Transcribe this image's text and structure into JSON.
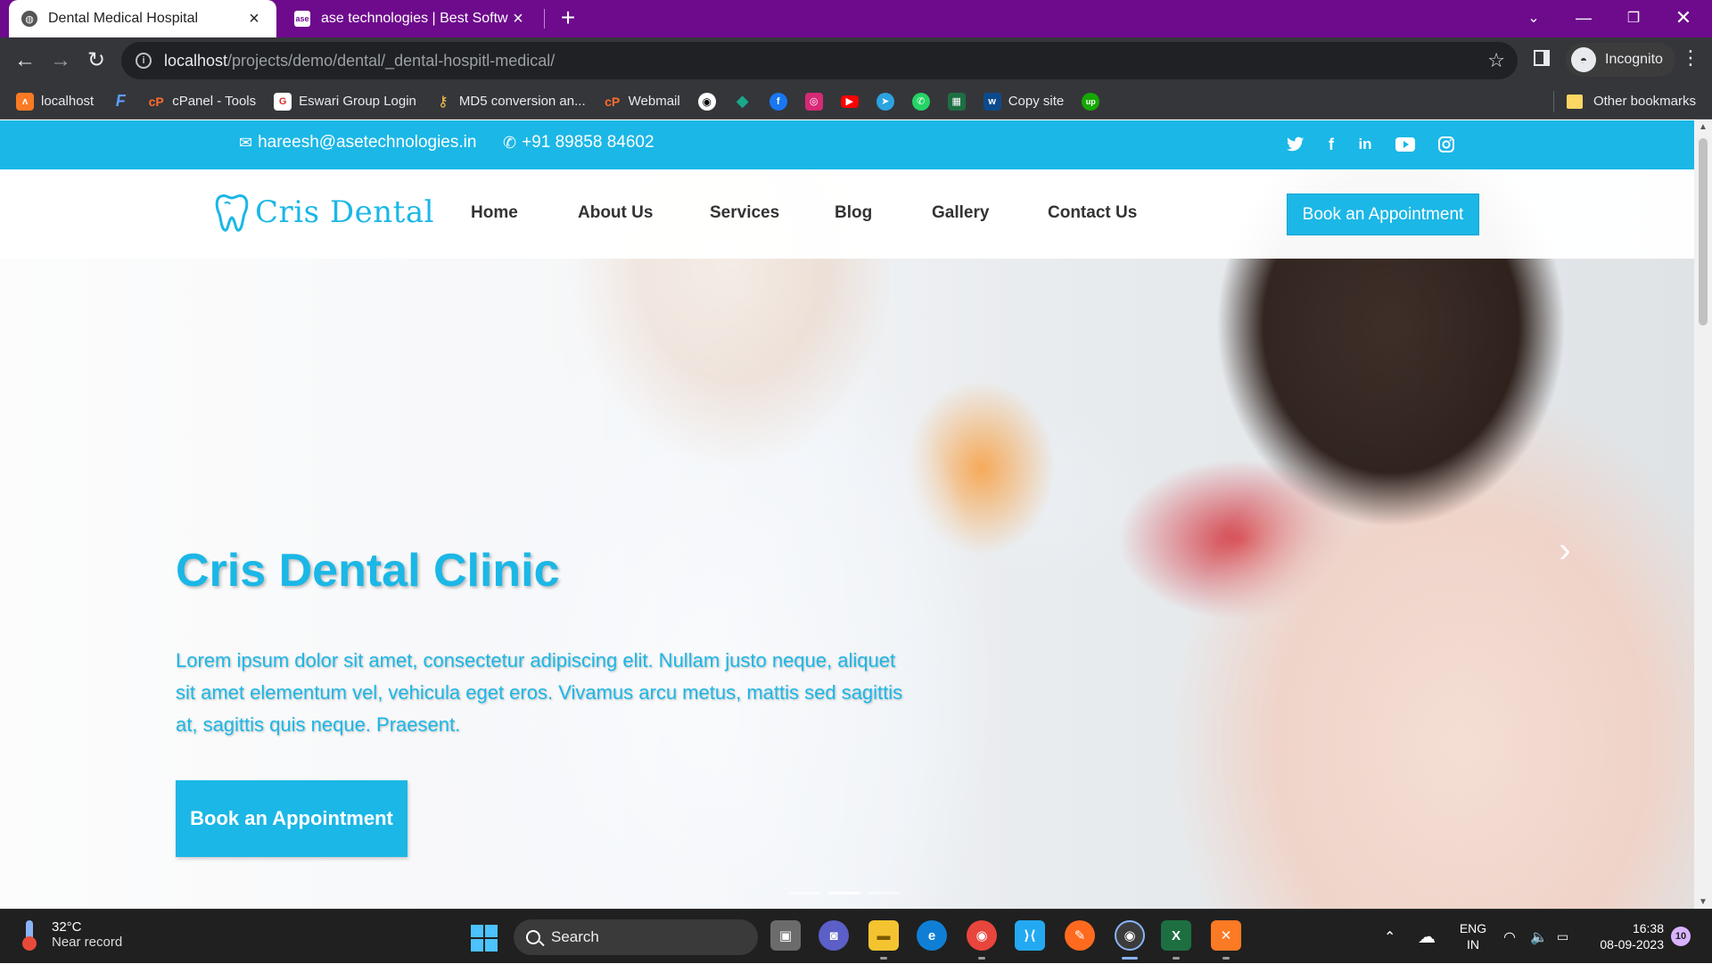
{
  "browser": {
    "tabs": [
      {
        "title": "Dental Medical Hospital",
        "active": true
      },
      {
        "title": "ase technologies | Best Software",
        "active": false
      }
    ],
    "new_tab": "+",
    "url_host": "localhost",
    "url_path": "/projects/demo/dental/_dental-hospitl-medical/",
    "profile": "Incognito",
    "bookmarks": [
      {
        "label": "localhost",
        "icon": "xampp-icon"
      },
      {
        "label": "",
        "icon": "frappe-icon"
      },
      {
        "label": "cPanel - Tools",
        "icon": "cpanel-icon"
      },
      {
        "label": "Eswari Group Login",
        "icon": "eswari-icon"
      },
      {
        "label": "MD5 conversion an...",
        "icon": "key-icon"
      },
      {
        "label": "Webmail",
        "icon": "cpanel-icon"
      },
      {
        "label": "",
        "icon": "github-icon"
      },
      {
        "label": "",
        "icon": "diamond-icon"
      },
      {
        "label": "",
        "icon": "facebook-icon"
      },
      {
        "label": "",
        "icon": "instagram-icon"
      },
      {
        "label": "",
        "icon": "youtube-icon"
      },
      {
        "label": "",
        "icon": "telegram-icon"
      },
      {
        "label": "",
        "icon": "whatsapp-icon"
      },
      {
        "label": "",
        "icon": "excel-sheet-icon"
      },
      {
        "label": "Copy site",
        "icon": "w-icon"
      },
      {
        "label": "",
        "icon": "upwork-icon"
      }
    ],
    "other_bookmarks": "Other bookmarks"
  },
  "site": {
    "email": "hareesh@asetechnologies.in",
    "phone": "+91 89858 84602",
    "social": [
      "twitter-icon",
      "facebook-icon",
      "linkedin-icon",
      "youtube-icon",
      "instagram-icon"
    ],
    "brand": "Cris Dental",
    "nav": [
      "Home",
      "About Us",
      "Services",
      "Blog",
      "Gallery",
      "Contact Us"
    ],
    "nav_cta": "Book an Appointment",
    "hero": {
      "title": "Cris Dental Clinic",
      "text": "Lorem ipsum dolor sit amet, consectetur adipiscing elit. Nullam justo neque, aliquet sit amet elementum vel, vehicula eget eros. Vivamus arcu metus, mattis sed sagittis at, sagittis quis neque. Praesent.",
      "cta": "Book an Appointment",
      "slides": 3,
      "active_slide": 2
    },
    "colors": {
      "accent": "#1bb7e6"
    }
  },
  "taskbar": {
    "weather_temp": "32°C",
    "weather_desc": "Near record",
    "search": "Search",
    "lang_top": "ENG",
    "lang_bottom": "IN",
    "time": "16:38",
    "date": "08-09-2023",
    "notifications": "10"
  }
}
